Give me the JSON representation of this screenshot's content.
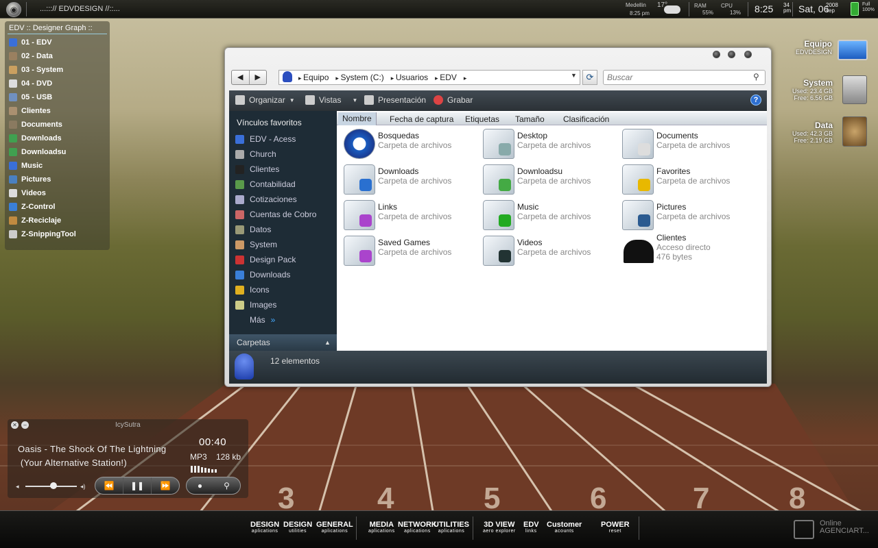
{
  "topbar": {
    "title": "...:::// EDVDESIGN //::...",
    "city": "Medellin",
    "city_time": "8:25 pm",
    "temp": "17°",
    "ram_label": "RAM",
    "ram_value": "55%",
    "cpu_label": "CPU",
    "cpu_value": "13%",
    "clock": "8:25",
    "clock_sec": "34",
    "clock_ampm": "pm",
    "date": "Sat, 06",
    "year": "2008",
    "month": "sep",
    "battery_label": "Full",
    "battery_value": "100%"
  },
  "left_menu": {
    "title": "EDV :: Designer Graph ::",
    "items": [
      "01 - EDV",
      "02 - Data",
      "03 - System",
      "04 - DVD",
      "05 - USB",
      "Clientes",
      "Documents",
      "Downloads",
      "Downloadsu",
      "Music",
      "Pictures",
      "Videos",
      "Z-Control",
      "Z-Reciclaje",
      "Z-SnippingTool"
    ]
  },
  "explorer": {
    "breadcrumb": [
      "Equipo",
      "System (C:)",
      "Usuarios",
      "EDV"
    ],
    "search_placeholder": "Buscar",
    "toolbar": [
      "Organizar",
      "Vistas",
      "Presentación",
      "Grabar"
    ],
    "nav_title": "Vínculos favoritos",
    "favorites": [
      "EDV - Acess",
      "Church",
      "Clientes",
      "Contabilidad",
      "Cotizaciones",
      "Cuentas de Cobro",
      "Datos",
      "System",
      "Design Pack",
      "Downloads",
      "Icons",
      "Images",
      "Más"
    ],
    "folders_label": "Carpetas",
    "columns": [
      "Nombre",
      "Fecha de captura",
      "Etiquetas",
      "Tamaño",
      "Clasificación"
    ],
    "items": [
      {
        "name": "Bosquedas",
        "type": "Carpeta de archivos"
      },
      {
        "name": "Desktop",
        "type": "Carpeta de archivos"
      },
      {
        "name": "Documents",
        "type": "Carpeta de archivos"
      },
      {
        "name": "Downloads",
        "type": "Carpeta de archivos"
      },
      {
        "name": "Downloadsu",
        "type": "Carpeta de archivos"
      },
      {
        "name": "Favorites",
        "type": "Carpeta de archivos"
      },
      {
        "name": "Links",
        "type": "Carpeta de archivos"
      },
      {
        "name": "Music",
        "type": "Carpeta de archivos"
      },
      {
        "name": "Pictures",
        "type": "Carpeta de archivos"
      },
      {
        "name": "Saved Games",
        "type": "Carpeta de archivos"
      },
      {
        "name": "Videos",
        "type": "Carpeta de archivos"
      },
      {
        "name": "Clientes",
        "type": "Acceso directo",
        "size": "476 bytes"
      }
    ],
    "status": "12 elementos"
  },
  "desktop": {
    "equipo": {
      "name": "Equipo",
      "sub": "EDVDESIGN"
    },
    "system": {
      "name": "System",
      "used": "Used: 23.4 GB",
      "free": "Free: 6.56 GB"
    },
    "data": {
      "name": "Data",
      "used": "Used: 42.3 GB",
      "free": "Free: 2.19 GB"
    }
  },
  "player": {
    "name": "IcySutra",
    "track_line1": "Oasis - The Shock Of The Lightning",
    "track_line2": "(Your Alternative Station!)",
    "time": "00:40",
    "format": "MP3",
    "bitrate": "128 kb",
    "volume": 0.55
  },
  "dock": [
    {
      "t": "DESIGN",
      "s": "aplications"
    },
    {
      "t": "DESIGN",
      "s": "utilities"
    },
    {
      "t": "GENERAL",
      "s": "aplications"
    },
    {
      "t": "MEDIA",
      "s": "aplications"
    },
    {
      "t": "NETWORK",
      "s": "aplications"
    },
    {
      "t": "UTILITIES",
      "s": "aplications"
    },
    {
      "t": "3D VIEW",
      "s": "aero explorer"
    },
    {
      "t": "EDV",
      "s": "links"
    },
    {
      "t": "Customer",
      "s": "acounts"
    },
    {
      "t": "POWER",
      "s": "reset"
    }
  ],
  "online": {
    "line1": "Online",
    "line2": "AGENCIART..."
  },
  "colors": {
    "accent": "#2e6fd0",
    "nav_pane": "#1e2c36",
    "toolbar": "#2b3136"
  }
}
